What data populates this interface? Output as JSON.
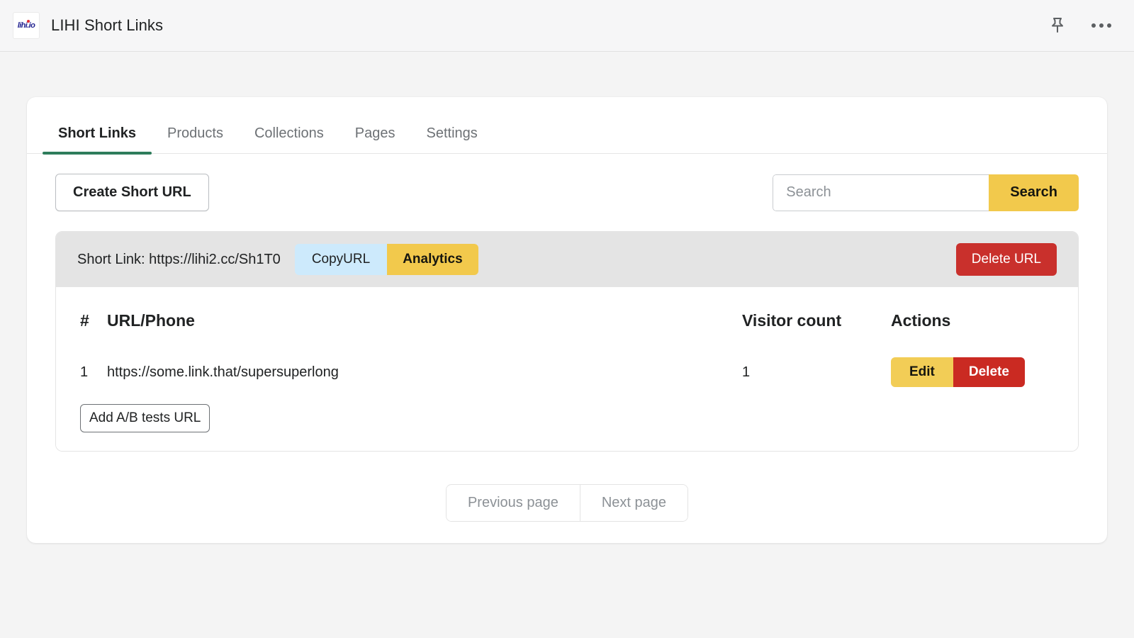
{
  "appbar": {
    "title": "LIHI Short Links",
    "logo_text": "lihi.io",
    "pin_icon": "pin-icon",
    "more_icon": "more-horizontal-icon"
  },
  "tabs": [
    {
      "label": "Short Links",
      "active": true
    },
    {
      "label": "Products",
      "active": false
    },
    {
      "label": "Collections",
      "active": false
    },
    {
      "label": "Pages",
      "active": false
    },
    {
      "label": "Settings",
      "active": false
    }
  ],
  "toolbar": {
    "create_label": "Create Short URL",
    "search_value": "",
    "search_placeholder": "Search",
    "search_button_label": "Search"
  },
  "link_block": {
    "short_link_label": "Short Link: https://lihi2.cc/Sh1T0",
    "copy_label": "CopyURL",
    "analytics_label": "Analytics",
    "delete_url_label": "Delete URL"
  },
  "table": {
    "headers": {
      "index": "#",
      "url": "URL/Phone",
      "visitor": "Visitor count",
      "actions": "Actions"
    },
    "rows": [
      {
        "index": "1",
        "url": "https://some.link.that/supersuperlong",
        "visitor_count": "1",
        "edit_label": "Edit",
        "delete_label": "Delete"
      }
    ],
    "add_ab_label": "Add A/B tests URL"
  },
  "pagination": {
    "previous_label": "Previous page",
    "next_label": "Next page"
  },
  "colors": {
    "accent_green": "#2e7d5b",
    "yellow": "#f2c94c",
    "light_blue": "#cdeafc",
    "red": "#c9302c",
    "page_bg": "#f4f4f4"
  }
}
